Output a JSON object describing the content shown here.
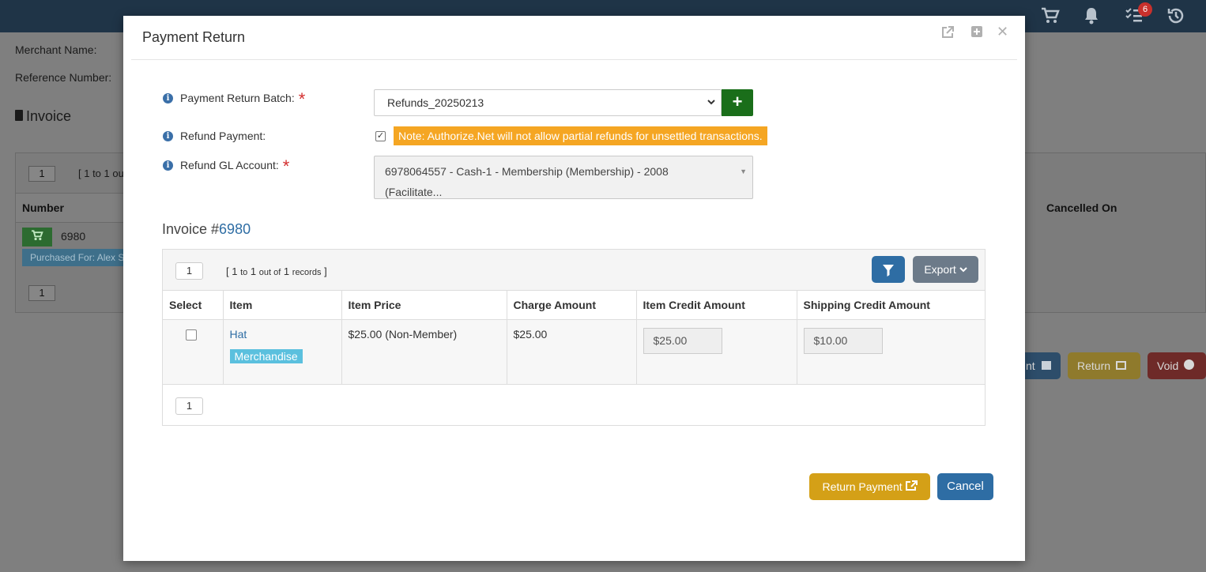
{
  "background": {
    "header": {
      "notification_count": "6"
    },
    "merchant_label": "Merchant Name:",
    "reference_label": "Reference Number:",
    "section_title": "Invoice",
    "pager_value": "1",
    "pager_text": "[ 1 to 1 ou",
    "columns": {
      "number": "Number",
      "cancelled_on": "Cancelled On"
    },
    "row": {
      "number": "6980",
      "purchased_for": "Purchased For: Alex S"
    },
    "buttons": {
      "print": "nt",
      "return": "Return",
      "void": "Void"
    },
    "colors": {
      "return": "#d4a017",
      "void": "#a02622",
      "print": "#2e6da4"
    }
  },
  "modal": {
    "title": "Payment Return",
    "fields": {
      "batch_label": "Payment Return Batch:",
      "batch_value": "Refunds_20250213",
      "refund_label": "Refund Payment:",
      "refund_note": "Note: Authorize.Net will not allow partial refunds for unsettled transactions.",
      "gl_label": "Refund GL Account:",
      "gl_value_line1": "6978064557 - Cash-1 - Membership (Membership) - 2008",
      "gl_value_line2": "(Facilitate..."
    },
    "invoice": {
      "prefix": "Invoice #",
      "number": "6980"
    },
    "grid": {
      "pager_value": "1",
      "pager_from": "1",
      "pager_to_word": "to",
      "pager_to": "1",
      "pager_outof": "out of",
      "pager_total": "1",
      "pager_records": "records",
      "export_label": "Export",
      "columns": {
        "select": "Select",
        "item": "Item",
        "item_price": "Item Price",
        "charge_amount": "Charge Amount",
        "item_credit": "Item Credit Amount",
        "shipping_credit": "Shipping Credit Amount"
      },
      "rows": [
        {
          "item": "Hat",
          "category": "Merchandise",
          "item_price": "$25.00 (Non-Member)",
          "charge_amount": "$25.00",
          "item_credit": "$25.00",
          "shipping_credit": "$10.00"
        }
      ],
      "footer_pager_value": "1"
    },
    "buttons": {
      "return_payment": "Return Payment",
      "cancel": "Cancel"
    }
  }
}
